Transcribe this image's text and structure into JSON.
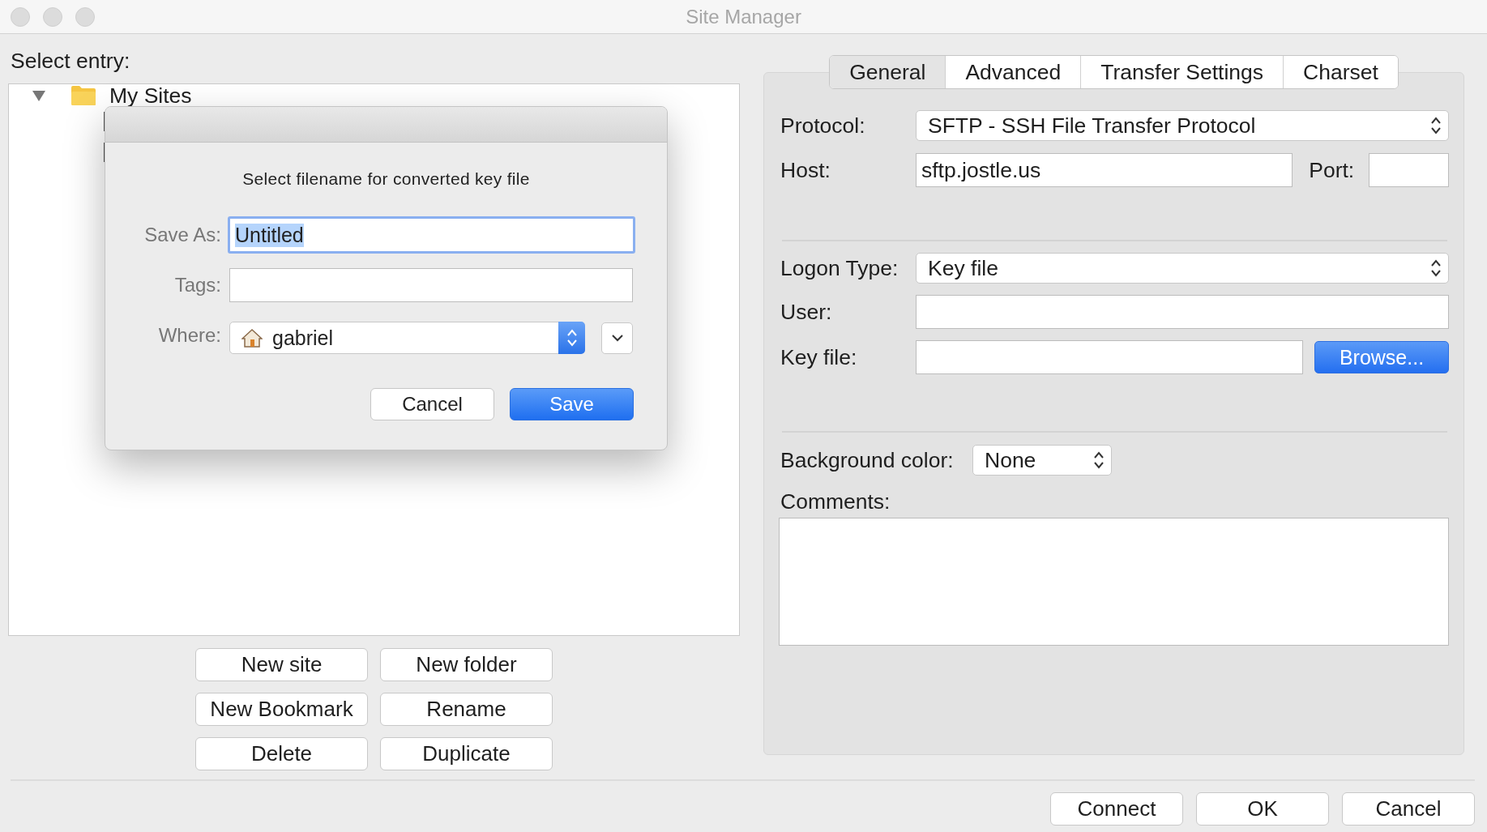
{
  "window": {
    "title": "Site Manager"
  },
  "tree": {
    "heading": "Select entry:",
    "items": [
      {
        "label": "My Sites",
        "expanded": true
      }
    ]
  },
  "tree_buttons": [
    "New site",
    "New folder",
    "New Bookmark",
    "Rename",
    "Delete",
    "Duplicate"
  ],
  "tabs": [
    {
      "label": "General",
      "selected": true
    },
    {
      "label": "Advanced",
      "selected": false
    },
    {
      "label": "Transfer Settings",
      "selected": false
    },
    {
      "label": "Charset",
      "selected": false
    }
  ],
  "general": {
    "protocol": {
      "label": "Protocol:",
      "value": "SFTP - SSH File Transfer Protocol"
    },
    "host": {
      "label": "Host:",
      "value": "sftp.jostle.us"
    },
    "port": {
      "label": "Port:"
    },
    "logon_type": {
      "label": "Logon Type:",
      "value": "Key file"
    },
    "user": {
      "label": "User:"
    },
    "key_file": {
      "label": "Key file:"
    },
    "browse_button": "Browse...",
    "background_color": {
      "label": "Background color:",
      "value": "None"
    },
    "comments": {
      "label": "Comments:"
    }
  },
  "footer_buttons": [
    "Connect",
    "OK",
    "Cancel"
  ],
  "save_dialog": {
    "message": "Select filename for converted key file",
    "save_as": {
      "label": "Save As:",
      "value": "Untitled",
      "text_selected": true
    },
    "tags": {
      "label": "Tags:"
    },
    "where": {
      "label": "Where:",
      "value": "gabriel"
    },
    "buttons": [
      {
        "label": "Cancel",
        "default": false
      },
      {
        "label": "Save",
        "default": true
      }
    ]
  }
}
